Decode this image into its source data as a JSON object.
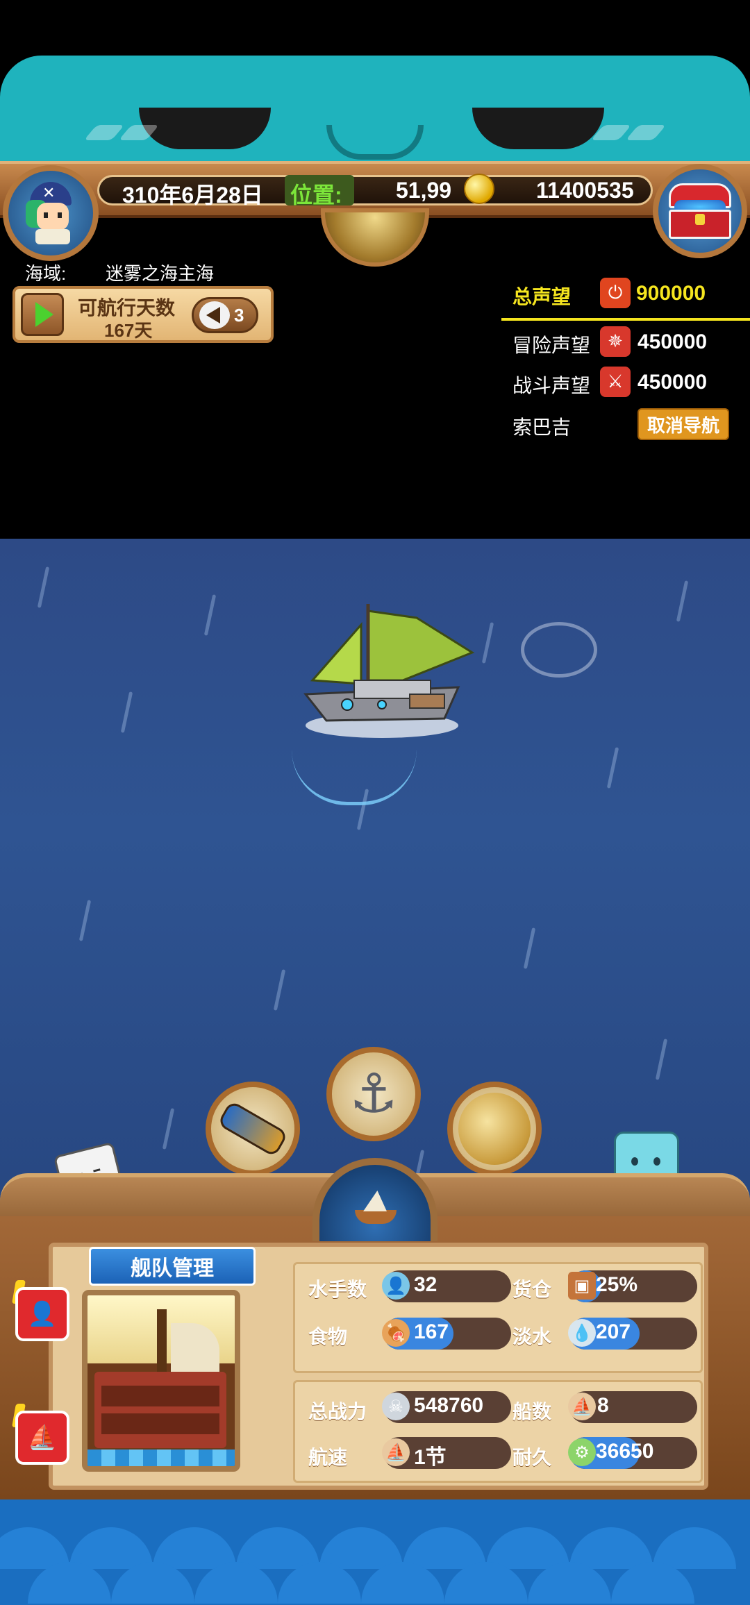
{
  "status_bar": {
    "date": "310年6月28日",
    "position_label": "位置:",
    "position_value": "51,99",
    "coins": "11400535"
  },
  "sea_area": {
    "label": "海域:",
    "name": "迷雾之海主海"
  },
  "sail_days": {
    "title": "可航行天数",
    "value": "167天",
    "back_count": "3"
  },
  "reputation": {
    "total_label": "总声望",
    "total_value": "900000",
    "adventure_label": "冒险声望",
    "adventure_value": "450000",
    "battle_label": "战斗声望",
    "battle_value": "450000",
    "destination": "索巴吉",
    "cancel_nav_label": "取消导航"
  },
  "colors": {
    "accent_yellow": "#f5e51f",
    "position_green": "#7ce63a",
    "cancel_orange": "#e0961f"
  },
  "fleet": {
    "title": "舰队管理",
    "sailors_label": "水手数",
    "sailors_value": "32",
    "cargo_label": "货仓",
    "cargo_value": "25%",
    "cargo_fill": 0.25,
    "food_label": "食物",
    "food_value": "167",
    "food_fill": 0.55,
    "water_label": "淡水",
    "water_value": "207",
    "water_fill": 0.55,
    "power_label": "总战力",
    "power_value": "548760",
    "ships_label": "船数",
    "ships_value": "8",
    "speed_label": "航速",
    "speed_value": "1节",
    "durability_label": "耐久",
    "durability_value": "36650",
    "durability_fill": 0.55
  },
  "icons": {
    "buttons": [
      "spyglass-icon",
      "anchor-icon",
      "world-map-icon",
      "ship-helm-icon"
    ]
  }
}
